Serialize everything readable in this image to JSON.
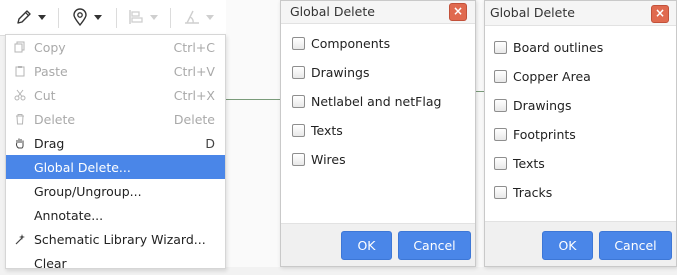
{
  "toolbar": {
    "icons": [
      "pencil-icon",
      "location-pin-icon",
      "align-icon",
      "measure-icon"
    ]
  },
  "menu": {
    "items": [
      {
        "label": "Copy",
        "shortcut": "Ctrl+C",
        "icon": "copy-icon",
        "state": "disabled"
      },
      {
        "label": "Paste",
        "shortcut": "Ctrl+V",
        "icon": "paste-icon",
        "state": "disabled"
      },
      {
        "label": "Cut",
        "shortcut": "Ctrl+X",
        "icon": "scissors-icon",
        "state": "disabled"
      },
      {
        "label": "Delete",
        "shortcut": "Delete",
        "icon": "trash-icon",
        "state": "disabled"
      },
      {
        "label": "Drag",
        "shortcut": "D",
        "icon": "hand-icon",
        "state": "enabled"
      },
      {
        "label": "Global Delete...",
        "shortcut": "",
        "icon": "",
        "state": "active"
      },
      {
        "label": "Group/Ungroup...",
        "shortcut": "",
        "icon": "",
        "state": "enabled"
      },
      {
        "label": "Annotate...",
        "shortcut": "",
        "icon": "",
        "state": "enabled"
      },
      {
        "label": "Schematic Library Wizard...",
        "shortcut": "",
        "icon": "wizard-icon",
        "state": "enabled"
      },
      {
        "label": "Clear",
        "shortcut": "",
        "icon": "",
        "state": "enabled"
      }
    ]
  },
  "dialog_schematic": {
    "title": "Global Delete",
    "options": [
      {
        "label": "Components",
        "checked": false
      },
      {
        "label": "Drawings",
        "checked": false
      },
      {
        "label": "Netlabel and netFlag",
        "checked": false
      },
      {
        "label": "Texts",
        "checked": false
      },
      {
        "label": "Wires",
        "checked": false
      }
    ],
    "ok_label": "OK",
    "cancel_label": "Cancel"
  },
  "dialog_pcb": {
    "title": "Global Delete",
    "options": [
      {
        "label": "Board outlines",
        "checked": false
      },
      {
        "label": "Copper Area",
        "checked": false
      },
      {
        "label": "Drawings",
        "checked": false
      },
      {
        "label": "Footprints",
        "checked": false
      },
      {
        "label": "Texts",
        "checked": false
      },
      {
        "label": "Tracks",
        "checked": false
      }
    ],
    "ok_label": "OK",
    "cancel_label": "Cancel"
  },
  "colors": {
    "accent": "#4a86e8",
    "close_button": "#e06a4f",
    "disabled_text": "#a9a9a9"
  }
}
